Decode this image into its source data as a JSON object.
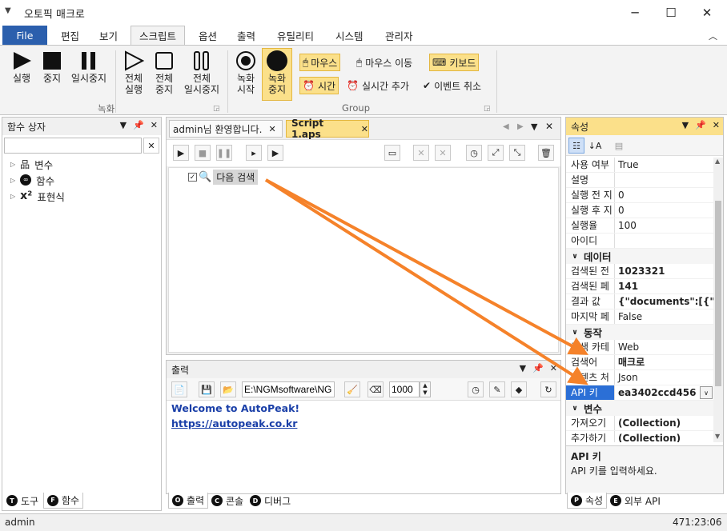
{
  "window": {
    "title": "오토픽 매크로"
  },
  "ribbon_tabs": [
    "File",
    "편집",
    "보기",
    "스크립트",
    "옵션",
    "출력",
    "유틸리티",
    "시스템",
    "관리자"
  ],
  "ribbon": {
    "run": "실행",
    "stop": "중지",
    "pause": "일시중지",
    "run_all": [
      "전체",
      "실행"
    ],
    "stop_all": [
      "전체",
      "중지"
    ],
    "pause_all": [
      "전체",
      "일시중지"
    ],
    "rec_start": [
      "녹화",
      "시작"
    ],
    "rec_stop": [
      "녹화",
      "중지"
    ],
    "mouse": "마우스",
    "mouse_move": "마우스 이동",
    "keyboard": "키보드",
    "time": "시간",
    "realtime_add": "실시간 추가",
    "event_cancel": "이벤트 취소",
    "group_record": "녹화",
    "group_group": "Group"
  },
  "func_box": {
    "title": "함수 상자",
    "search_value": "",
    "items": [
      "변수",
      "함수",
      "표현식"
    ]
  },
  "doc_tabs": [
    "admin님 환영합니다.",
    "Script 1.aps"
  ],
  "script": {
    "node_label": "다음 검색"
  },
  "output": {
    "title": "출력",
    "path": "E:\\NGMsoftware\\NG",
    "count": "1000",
    "welcome": "Welcome to AutoPeak!",
    "link": "https://autopeak.co.kr"
  },
  "props": {
    "title": "속성",
    "rows_general": [
      {
        "name": "사용 여부",
        "value": "True"
      },
      {
        "name": "설명",
        "value": ""
      },
      {
        "name": "실행 전 지",
        "value": "0"
      },
      {
        "name": "실행 후 지",
        "value": "0"
      },
      {
        "name": "실행율",
        "value": "100"
      },
      {
        "name": "아이디",
        "value": ""
      }
    ],
    "cat_data": "데이터",
    "rows_data": [
      {
        "name": "검색된 전",
        "value": "1023321"
      },
      {
        "name": "검색된 페",
        "value": "141"
      },
      {
        "name": "결과 값",
        "value": "{\"documents\":[{\""
      },
      {
        "name": "마지막 페",
        "value": "False"
      }
    ],
    "cat_action": "동작",
    "rows_action": [
      {
        "name": "검색 카테",
        "value": "Web"
      },
      {
        "name": "검색어",
        "value": "매크로"
      },
      {
        "name": "컨텐츠 처",
        "value": "Json"
      },
      {
        "name": "API 키",
        "value": "ea3402ccd456"
      }
    ],
    "cat_var": "변수",
    "rows_var": [
      {
        "name": "가져오기",
        "value": "(Collection)"
      },
      {
        "name": "추가하기",
        "value": "(Collection)"
      }
    ],
    "desc_title": "API 키",
    "desc_text": "API 키를 입력하세요."
  },
  "bottom_tabs_left": [
    {
      "badge": "T",
      "label": "도구"
    },
    {
      "badge": "F",
      "label": "함수"
    }
  ],
  "bottom_tabs_mid": [
    {
      "badge": "O",
      "label": "출력"
    },
    {
      "badge": "C",
      "label": "콘솔"
    },
    {
      "badge": "D",
      "label": "디버그"
    }
  ],
  "bottom_tabs_right": [
    {
      "badge": "P",
      "label": "속성"
    },
    {
      "badge": "E",
      "label": "외부 API"
    }
  ],
  "status": {
    "user": "admin",
    "time": "471:23:06"
  },
  "colors": {
    "accent": "#2b5fad",
    "highlight": "#fbe08a",
    "arrow": "#f5822a",
    "selection": "#2b6fd6"
  }
}
